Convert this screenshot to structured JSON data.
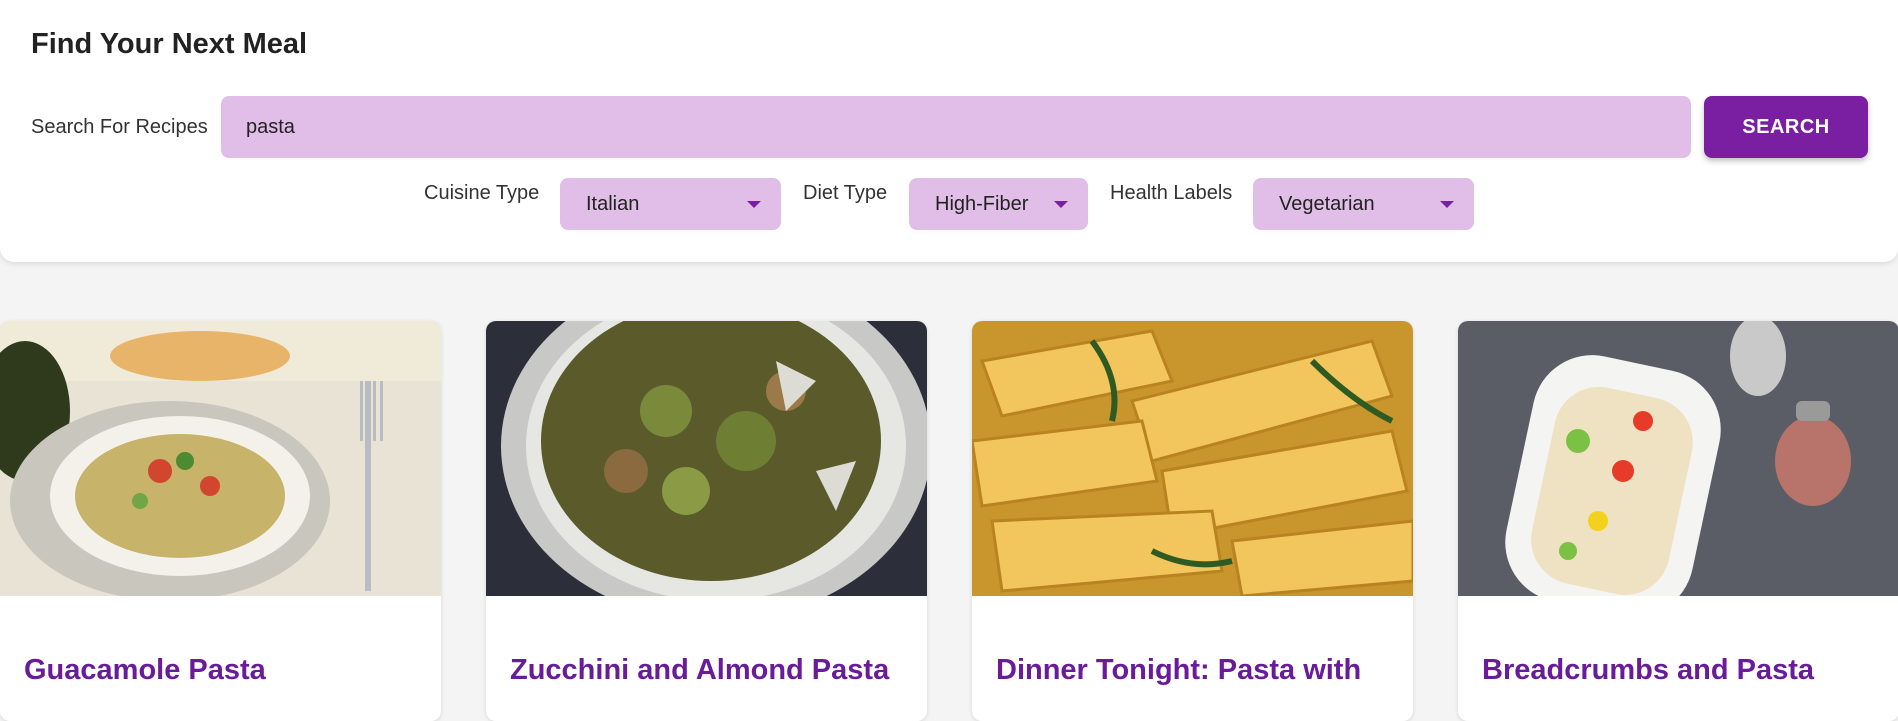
{
  "header": {
    "title": "Find Your Next Meal"
  },
  "search": {
    "label": "Search For Recipes",
    "value": "pasta",
    "button_label": "SEARCH"
  },
  "filters": {
    "cuisine": {
      "label": "Cuisine Type",
      "value": "Italian"
    },
    "diet": {
      "label": "Diet Type",
      "value": "High-Fiber"
    },
    "health": {
      "label": "Health Labels",
      "value": "Vegetarian"
    }
  },
  "recipes": [
    {
      "title": "Guacamole Pasta",
      "image_icon": "guacamole-pasta-photo"
    },
    {
      "title": "Zucchini and Almond Pasta",
      "image_icon": "zucchini-pasta-photo"
    },
    {
      "title": "Dinner Tonight: Pasta with",
      "image_icon": "penne-pasta-photo"
    },
    {
      "title": "Breadcrumbs and Pasta",
      "image_icon": "pasta-salad-photo"
    }
  ],
  "colors": {
    "accent": "#7b1fa2",
    "field_background": "#e1bee7",
    "card_title": "#6a1b9a"
  }
}
